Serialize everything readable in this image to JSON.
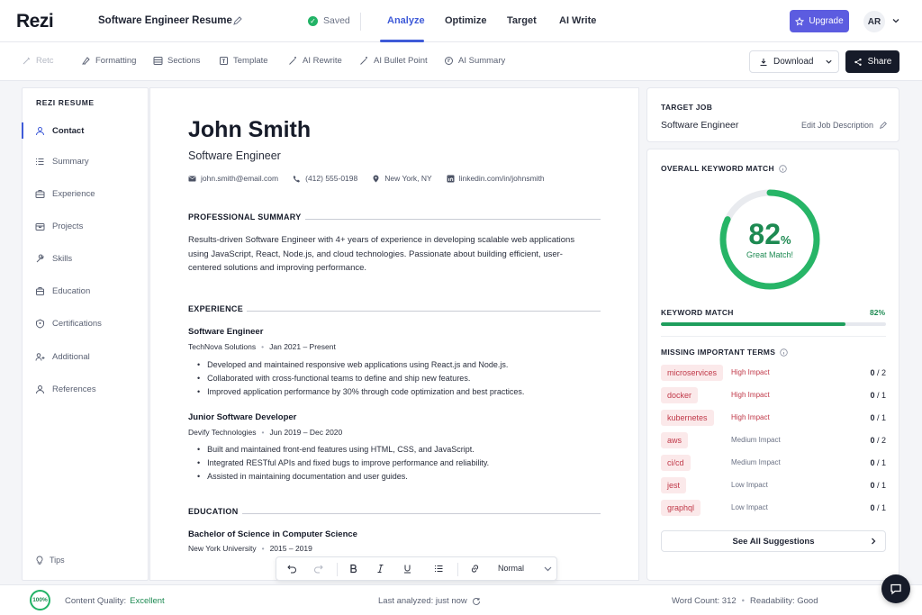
{
  "header": {
    "logo": "Rezi",
    "doc_title": "Software Engineer Resume",
    "saved_label": "Saved",
    "tabs": [
      {
        "label": "Analyze",
        "active": true
      },
      {
        "label": "Optimize",
        "active": false
      },
      {
        "label": "Target",
        "active": false
      },
      {
        "label": "AI Write",
        "active": false
      }
    ],
    "upgrade_label": "Upgrade",
    "avatar_initials": "AR"
  },
  "toolbar": {
    "items": [
      {
        "label": "Retc",
        "icon": "retouch-icon"
      },
      {
        "label": "Formatting",
        "icon": "formatting-icon"
      },
      {
        "label": "Sections",
        "icon": "sections-icon"
      },
      {
        "label": "Template",
        "icon": "template-icon"
      },
      {
        "label": "AI Rewrite",
        "icon": "magic-wand-icon"
      },
      {
        "label": "AI Bullet Point",
        "icon": "magic-wand-icon"
      },
      {
        "label": "AI Summary",
        "icon": "ai-summary-icon"
      }
    ],
    "download_label": "Download",
    "share_label": "Share"
  },
  "sidebar": {
    "heading": "REZI RESUME",
    "items": [
      {
        "label": "Contact",
        "icon": "user-icon",
        "active": true
      },
      {
        "label": "Summary",
        "icon": "list-icon",
        "active": false
      },
      {
        "label": "Experience",
        "icon": "briefcase-icon",
        "active": false
      },
      {
        "label": "Projects",
        "icon": "folder-icon",
        "active": false
      },
      {
        "label": "Skills",
        "icon": "wrench-icon",
        "active": false
      },
      {
        "label": "Education",
        "icon": "education-icon",
        "active": false
      },
      {
        "label": "Certifications",
        "icon": "badge-icon",
        "active": false
      },
      {
        "label": "Additional",
        "icon": "people-icon",
        "active": false
      },
      {
        "label": "References",
        "icon": "user-icon",
        "active": false
      }
    ],
    "tips_label": "Tips"
  },
  "resume": {
    "name": "John Smith",
    "role": "Software Engineer",
    "contact": {
      "email": "john.smith@email.com",
      "phone": "(412) 555-0198",
      "location": "New York, NY",
      "linkedin": "linkedin.com/in/johnsmith"
    },
    "summary_heading": "PROFESSIONAL SUMMARY",
    "summary_text": "Results-driven Software Engineer with 4+ years of experience in developing scalable web applications using JavaScript, React, Node.js, and cloud technologies. Passionate about building efficient, user-centered solutions and improving performance.",
    "experience_heading": "EXPERIENCE",
    "jobs": [
      {
        "title": "Software Engineer",
        "company": "TechNova Solutions",
        "dates": "Jan 2021 – Present",
        "bullets": [
          "Developed and maintained responsive web applications using React.js and Node.js.",
          "Collaborated with cross-functional teams to define and ship new features.",
          "Improved application performance by 30% through code optimization and best practices."
        ]
      },
      {
        "title": "Junior Software Developer",
        "company": "Devify Technologies",
        "dates": "Jun 2019 – Dec 2020",
        "bullets": [
          "Built and maintained front-end features using HTML, CSS, and JavaScript.",
          "Integrated RESTful APIs and fixed bugs to improve performance and reliability.",
          "Assisted in maintaining documentation and user guides."
        ]
      }
    ],
    "education_heading": "EDUCATION",
    "education": {
      "degree": "Bachelor of Science in Computer Science",
      "school": "New York University",
      "dates": "2015 – 2019"
    }
  },
  "editor": {
    "style_select": "Normal"
  },
  "target_job": {
    "label": "TARGET JOB",
    "value": "Software Engineer",
    "edit_label": "Edit Job Description"
  },
  "keyword": {
    "label": "OVERALL KEYWORD MATCH",
    "percent_number": "82",
    "percent_sign": "%",
    "percent_value": 82,
    "status": "Great Match!",
    "bar_label": "KEYWORD MATCH",
    "bar_value": "82%",
    "missing_label": "MISSING IMPORTANT TERMS",
    "terms": [
      {
        "term": "microservices",
        "impact": "High Impact",
        "level": "high",
        "found": "0",
        "total": "/ 2"
      },
      {
        "term": "docker",
        "impact": "High Impact",
        "level": "high",
        "found": "0",
        "total": "/ 1"
      },
      {
        "term": "kubernetes",
        "impact": "High Impact",
        "level": "high",
        "found": "0",
        "total": "/ 1"
      },
      {
        "term": "aws",
        "impact": "Medium Impact",
        "level": "other",
        "found": "0",
        "total": "/ 2"
      },
      {
        "term": "ci/cd",
        "impact": "Medium Impact",
        "level": "other",
        "found": "0",
        "total": "/ 1"
      },
      {
        "term": "jest",
        "impact": "Low Impact",
        "level": "other",
        "found": "0",
        "total": "/ 1"
      },
      {
        "term": "graphql",
        "impact": "Low Impact",
        "level": "other",
        "found": "0",
        "total": "/ 1"
      }
    ],
    "see_all_label": "See All Suggestions"
  },
  "footer": {
    "quality_ring": "100%",
    "quality_label": "Content Quality:",
    "quality_value": "Excellent",
    "last_analyzed": "Last analyzed:  just now",
    "word_count": "Word Count:  312",
    "readability": "Readability:  Good"
  },
  "colors": {
    "accent": "#3f5bd8",
    "success": "#1d8a52",
    "danger": "#c03848"
  }
}
